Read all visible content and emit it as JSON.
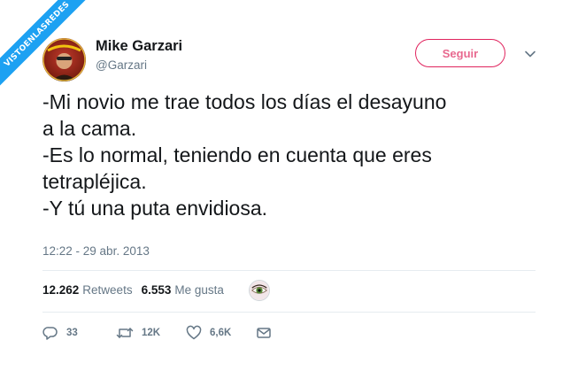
{
  "watermark": {
    "text": "VISTOENLASREDES"
  },
  "author": {
    "display_name": "Mike Garzari",
    "handle": "@Garzari",
    "avatar_icon": "profile-photo"
  },
  "follow_button": {
    "label": "Seguir"
  },
  "menu": {
    "icon": "chevron-down-icon"
  },
  "tweet": {
    "lines": [
      "-Mi novio me trae todos los días el desayuno",
      "a la cama.",
      "-Es lo normal, teniendo en cuenta que eres",
      "tetrapléjica.",
      "-Y tú una puta envidiosa."
    ],
    "timestamp": "12:22 - 29 abr. 2013"
  },
  "stats": {
    "retweets_count": "12.262",
    "retweets_label": "Retweets",
    "likes_count": "6.553",
    "likes_label": "Me gusta"
  },
  "actions": {
    "reply_count": "33",
    "retweet_count": "12K",
    "like_count": "6,6K"
  },
  "colors": {
    "accent": "#1da1f2",
    "follow": "#e0245e",
    "secondary_text": "#657786",
    "divider": "#e6ecf0"
  }
}
